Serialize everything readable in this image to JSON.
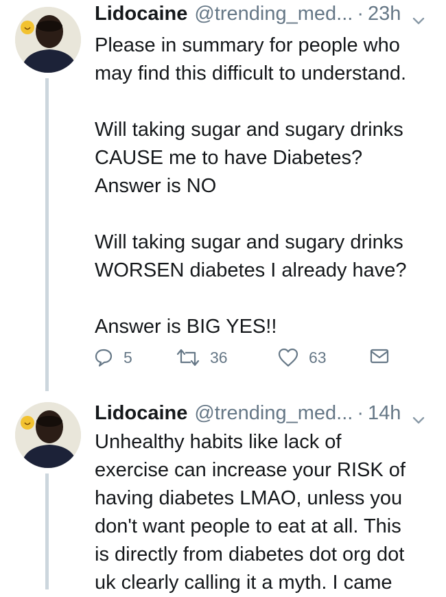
{
  "tweets": [
    {
      "author_name": "Lidocaine",
      "handle": "@trending_med...",
      "separator": "·",
      "time": "23h",
      "lines": [
        [
          "Please in summary for people who",
          "may find this difficult to understand."
        ],
        [
          "Will taking sugar and sugary drinks",
          "CAUSE me to have Diabetes?",
          "Answer is NO"
        ],
        [
          "Will taking sugar and sugary drinks",
          "WORSEN diabetes I already have?"
        ],
        [
          "Answer is BIG YES!!"
        ]
      ],
      "actions": {
        "replies": "5",
        "retweets": "36",
        "likes": "63"
      }
    },
    {
      "author_name": "Lidocaine",
      "handle": "@trending_med...",
      "separator": "·",
      "time": "14h",
      "lines": [
        [
          "Unhealthy habits like lack of",
          "exercise can increase your RISK of",
          "having diabetes LMAO, unless you",
          "don't want people to eat at all. This",
          "is directly from diabetes dot org dot",
          "uk clearly calling it a myth. I came"
        ]
      ]
    }
  ],
  "icons": {
    "reply": "reply-icon",
    "retweet": "retweet-icon",
    "like": "heart-icon",
    "dm": "envelope-icon",
    "caret": "chevron-down-icon"
  },
  "colors": {
    "text": "#14171a",
    "secondary": "#657786",
    "thread_line": "#ccd6dd"
  }
}
